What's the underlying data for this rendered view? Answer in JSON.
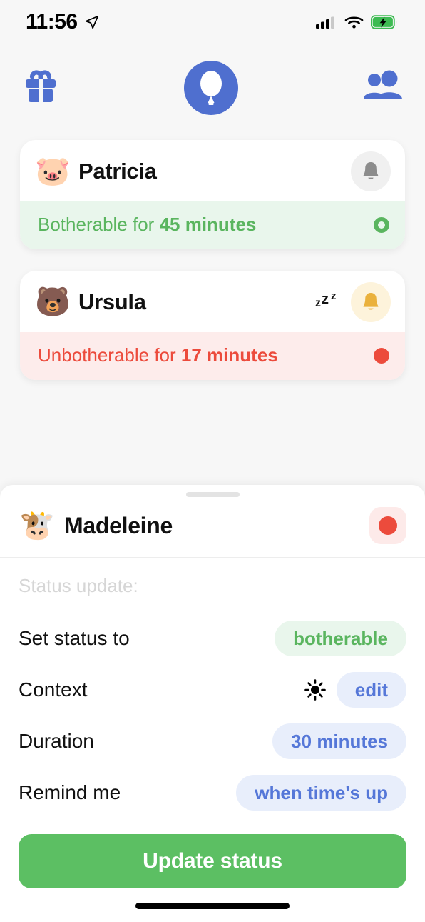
{
  "status_bar": {
    "time": "11:56",
    "location_icon": "location-arrow-icon",
    "cellular_icon": "cellular-signal-icon",
    "wifi_icon": "wifi-icon",
    "battery_icon": "battery-charging-icon"
  },
  "top_nav": {
    "left_icon": "gift-icon",
    "logo_icon": "balloon-logo-icon",
    "right_icon": "people-icon",
    "logo_color": "#4f6fcf",
    "icon_color": "#4f6fcf"
  },
  "friends": [
    {
      "name": "Patricia",
      "emoji": "🐷",
      "emoji_name": "pig-face-emoji",
      "bell_icon": "bell-icon",
      "bell_state": "muted",
      "sleeping": false,
      "status_prefix": "Botherable for ",
      "status_value": "45 minutes",
      "status_type": "botherable",
      "indicator": "ring",
      "color": "#5ab55f",
      "bg": "#e9f6ec"
    },
    {
      "name": "Ursula",
      "emoji": "🐻",
      "emoji_name": "bear-face-emoji",
      "bell_icon": "bell-icon",
      "bell_state": "active",
      "sleeping": true,
      "sleep_icon": "zzz-sleep-icon",
      "status_prefix": "Unbotherable for ",
      "status_value": "17 minutes",
      "status_type": "unbotherable",
      "indicator": "solid",
      "color": "#ec4b3c",
      "bg": "#fdeceb"
    }
  ],
  "sheet": {
    "grabber": "drag-handle",
    "user": {
      "name": "Madeleine",
      "emoji": "🐮",
      "emoji_name": "cow-face-emoji",
      "badge_icon": "red-dot-status-icon",
      "badge_color": "#ec4b3c"
    },
    "section_label": "Status update:",
    "rows": [
      {
        "label": "Set status to",
        "value": "botherable",
        "pill_style": "green",
        "icon": null
      },
      {
        "label": "Context",
        "value": "edit",
        "pill_style": "blue",
        "icon": "sun-icon"
      },
      {
        "label": "Duration",
        "value": "30 minutes",
        "pill_style": "blue",
        "icon": null
      },
      {
        "label": "Remind me",
        "value": "when time's up",
        "pill_style": "blue",
        "icon": null
      }
    ],
    "submit_label": "Update status",
    "submit_color": "#5cbf63"
  },
  "home_indicator": "home-indicator-bar"
}
